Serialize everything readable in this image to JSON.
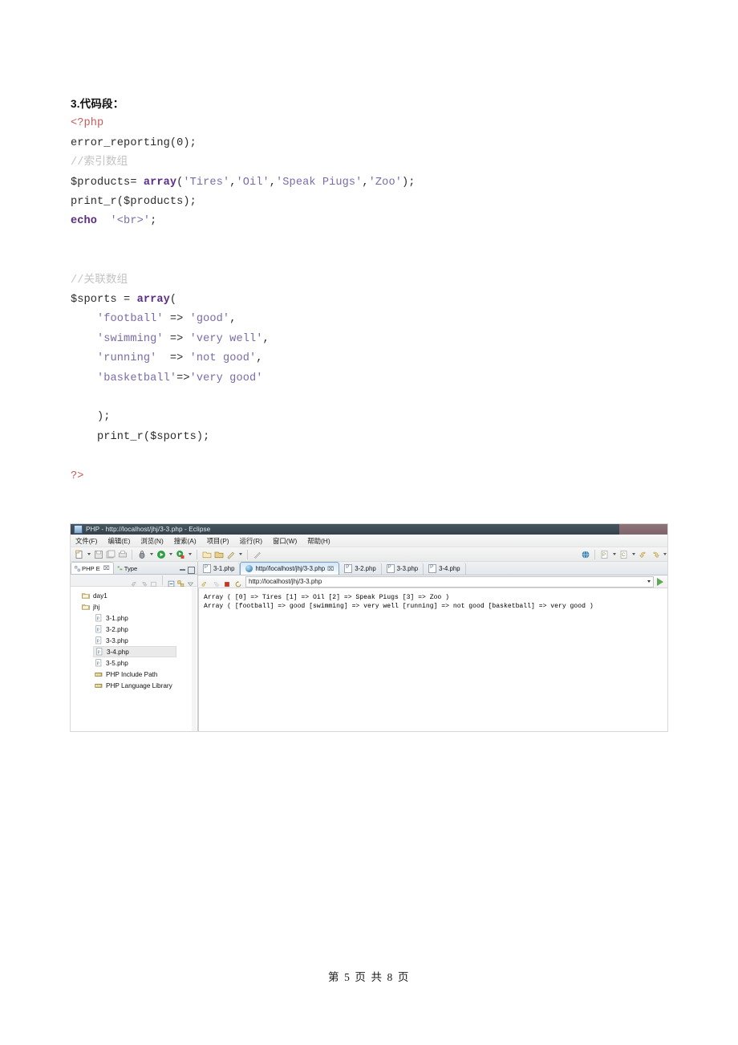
{
  "document": {
    "heading": "3.代码段：",
    "code_lines": [
      {
        "type": "line",
        "tokens": [
          {
            "cls": "c-tag",
            "t": "<?php"
          }
        ]
      },
      {
        "type": "line",
        "tokens": [
          {
            "cls": "c-plain",
            "t": "error_reporting(0);"
          }
        ]
      },
      {
        "type": "line",
        "tokens": [
          {
            "cls": "c-comment",
            "t": "//索引数组"
          }
        ]
      },
      {
        "type": "line",
        "tokens": [
          {
            "cls": "c-plain",
            "t": "$products= "
          },
          {
            "cls": "c-kw",
            "t": "array"
          },
          {
            "cls": "c-plain",
            "t": "("
          },
          {
            "cls": "c-str",
            "t": "'Tires'"
          },
          {
            "cls": "c-plain",
            "t": ","
          },
          {
            "cls": "c-str",
            "t": "'Oil'"
          },
          {
            "cls": "c-plain",
            "t": ","
          },
          {
            "cls": "c-str",
            "t": "'Speak Piugs'"
          },
          {
            "cls": "c-plain",
            "t": ","
          },
          {
            "cls": "c-str",
            "t": "'Zoo'"
          },
          {
            "cls": "c-plain",
            "t": ");"
          }
        ]
      },
      {
        "type": "line",
        "tokens": [
          {
            "cls": "c-plain",
            "t": "print_r($products);"
          }
        ]
      },
      {
        "type": "line",
        "tokens": [
          {
            "cls": "c-kw",
            "t": "echo"
          },
          {
            "cls": "c-plain",
            "t": "  "
          },
          {
            "cls": "c-str",
            "t": "'<br>'"
          },
          {
            "cls": "c-plain",
            "t": ";"
          }
        ]
      },
      {
        "type": "gap2"
      },
      {
        "type": "gap2"
      },
      {
        "type": "line",
        "tokens": [
          {
            "cls": "c-comment",
            "t": "//关联数组"
          }
        ]
      },
      {
        "type": "line",
        "tokens": [
          {
            "cls": "c-plain",
            "t": "$sports = "
          },
          {
            "cls": "c-kw",
            "t": "array"
          },
          {
            "cls": "c-plain",
            "t": "("
          }
        ]
      },
      {
        "type": "line",
        "tokens": [
          {
            "cls": "c-plain",
            "t": "    "
          },
          {
            "cls": "c-str",
            "t": "'football'"
          },
          {
            "cls": "c-plain",
            "t": " => "
          },
          {
            "cls": "c-str",
            "t": "'good'"
          },
          {
            "cls": "c-plain",
            "t": ","
          }
        ]
      },
      {
        "type": "line",
        "tokens": [
          {
            "cls": "c-plain",
            "t": "    "
          },
          {
            "cls": "c-str",
            "t": "'swimming'"
          },
          {
            "cls": "c-plain",
            "t": " => "
          },
          {
            "cls": "c-str",
            "t": "'very well'"
          },
          {
            "cls": "c-plain",
            "t": ","
          }
        ]
      },
      {
        "type": "line",
        "tokens": [
          {
            "cls": "c-plain",
            "t": "    "
          },
          {
            "cls": "c-str",
            "t": "'running'"
          },
          {
            "cls": "c-plain",
            "t": "  => "
          },
          {
            "cls": "c-str",
            "t": "'not good'"
          },
          {
            "cls": "c-plain",
            "t": ","
          }
        ]
      },
      {
        "type": "line",
        "tokens": [
          {
            "cls": "c-plain",
            "t": "    "
          },
          {
            "cls": "c-str",
            "t": "'basketball'"
          },
          {
            "cls": "c-plain",
            "t": "=>"
          },
          {
            "cls": "c-str",
            "t": "'very good'"
          }
        ]
      },
      {
        "type": "gap"
      },
      {
        "type": "line",
        "tokens": [
          {
            "cls": "c-plain",
            "t": "    );"
          }
        ]
      },
      {
        "type": "line",
        "tokens": [
          {
            "cls": "c-plain",
            "t": "    print_r($sports);"
          }
        ]
      },
      {
        "type": "gap"
      },
      {
        "type": "line",
        "tokens": [
          {
            "cls": "c-tag",
            "t": "?>"
          }
        ]
      }
    ],
    "footer": "第 5 页  共 8 页"
  },
  "eclipse": {
    "title": "PHP  -  http://localhost/jhj/3-3.php  -  Eclipse",
    "menu": [
      {
        "label": "文件(F)"
      },
      {
        "label": "编辑(E)"
      },
      {
        "label": "浏览(N)"
      },
      {
        "label": "搜索(A)"
      },
      {
        "label": "项目(P)"
      },
      {
        "label": "运行(R)"
      },
      {
        "label": "窗口(W)"
      },
      {
        "label": "帮助(H)"
      }
    ],
    "explorer": {
      "tabs": [
        {
          "label": "PHP E",
          "active": true
        },
        {
          "label": "Type",
          "active": false
        }
      ],
      "tree": [
        {
          "label": "day1",
          "kind": "folder",
          "depth": 1,
          "selected": false
        },
        {
          "label": "jhj",
          "kind": "folder",
          "depth": 1,
          "selected": false
        },
        {
          "label": "3-1.php",
          "kind": "php",
          "depth": 2,
          "selected": false
        },
        {
          "label": "3-2.php",
          "kind": "php",
          "depth": 2,
          "selected": false
        },
        {
          "label": "3-3.php",
          "kind": "php",
          "depth": 2,
          "selected": false
        },
        {
          "label": "3-4.php",
          "kind": "php",
          "depth": 2,
          "selected": true
        },
        {
          "label": "3-5.php",
          "kind": "php",
          "depth": 2,
          "selected": false
        },
        {
          "label": "PHP Include Path",
          "kind": "lib",
          "depth": 2,
          "selected": false
        },
        {
          "label": "PHP Language Library",
          "kind": "lib",
          "depth": 2,
          "selected": false
        }
      ]
    },
    "editor": {
      "tabs": [
        {
          "label": "3-1.php",
          "icon": "php-file-icon",
          "active": false,
          "closable": false
        },
        {
          "label": "http//localhost/jhj/3-3.php",
          "icon": "globe-icon",
          "active": true,
          "closable": true
        },
        {
          "label": "3-2.php",
          "icon": "php-file-icon",
          "active": false,
          "closable": false
        },
        {
          "label": "3-3.php",
          "icon": "php-file-icon",
          "active": false,
          "closable": false
        },
        {
          "label": "3-4.php",
          "icon": "php-file-icon",
          "active": false,
          "closable": false
        }
      ],
      "address": "http://localhost/jhj/3-3.php",
      "output_lines": [
        "Array ( [0] => Tires [1] => Oil [2] => Speak Piugs [3] => Zoo )",
        "Array ( [football] => good [swimming] => very well [running] => not good [basketball] => very good )"
      ]
    },
    "colors": {
      "titlebar": "#3c4a55",
      "active_tab": "#d5e6f5",
      "selection": "#eaeaea"
    }
  }
}
